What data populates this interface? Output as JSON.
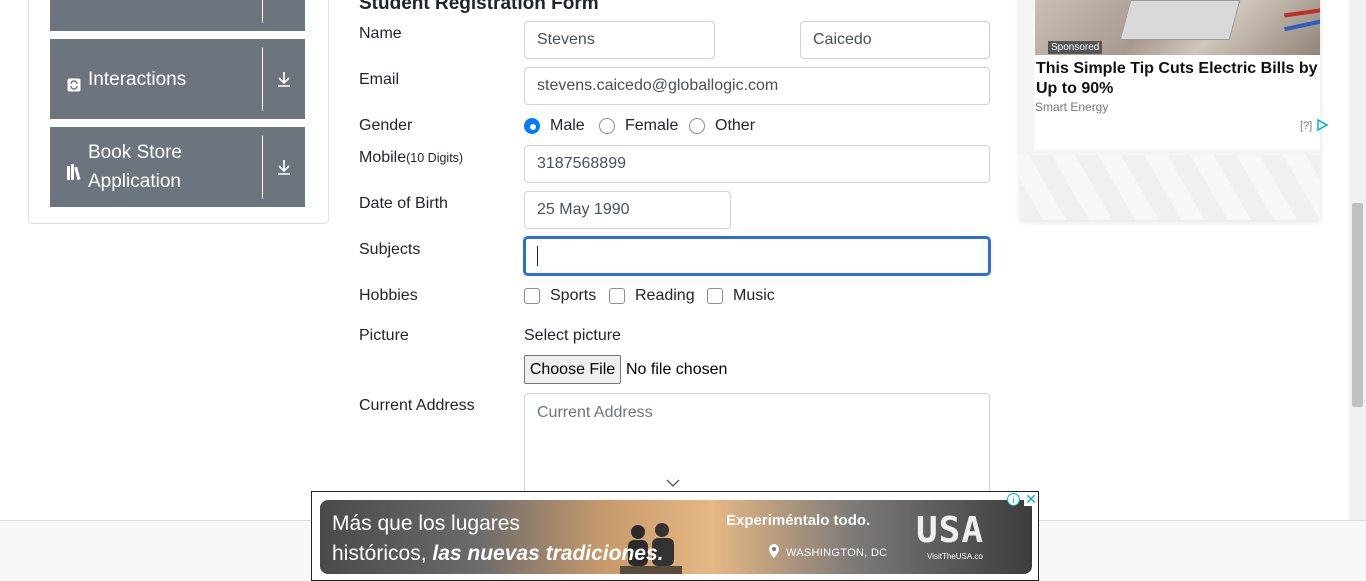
{
  "sidebar": {
    "items": [
      {
        "label": ""
      },
      {
        "label": "Interactions"
      },
      {
        "label": "Book Store Application"
      }
    ]
  },
  "form": {
    "title": "Student Registration Form",
    "name_label": "Name",
    "first_name": "Stevens",
    "last_name": "Caicedo",
    "email_label": "Email",
    "email": "stevens.caicedo@globallogic.com",
    "gender_label": "Gender",
    "gender_options": [
      "Male",
      "Female",
      "Other"
    ],
    "mobile_label": "Mobile",
    "mobile_hint": "(10 Digits)",
    "mobile": "3187568899",
    "dob_label": "Date of Birth",
    "dob": "25 May 1990",
    "subjects_label": "Subjects",
    "subjects": "",
    "hobbies_label": "Hobbies",
    "hobby_options": [
      "Sports",
      "Reading",
      "Music"
    ],
    "picture_label": "Picture",
    "picture_prompt": "Select picture",
    "file_button": "Choose File",
    "file_status": "No file chosen",
    "address_label": "Current Address",
    "address_placeholder": "Current Address"
  },
  "ad_right": {
    "sponsored": "Sponsored",
    "headline": "This Simple Tip Cuts Electric Bills by Up to 90%",
    "source": "Smart Energy",
    "adchoices": "[?]"
  },
  "banner": {
    "line1": "Más que los lugares",
    "line2_plain": "históricos, ",
    "line2_bold": "las nuevas tradiciones.",
    "tagline": "Experiméntalo todo.",
    "location": "WASHINGTON, DC",
    "brand": "USA",
    "brand_url": "VisitTheUSA.co"
  },
  "colors": {
    "sidebar_button": "#6c757d",
    "radio_selected": "#007bff",
    "focus_border": "#2a6fdb"
  }
}
